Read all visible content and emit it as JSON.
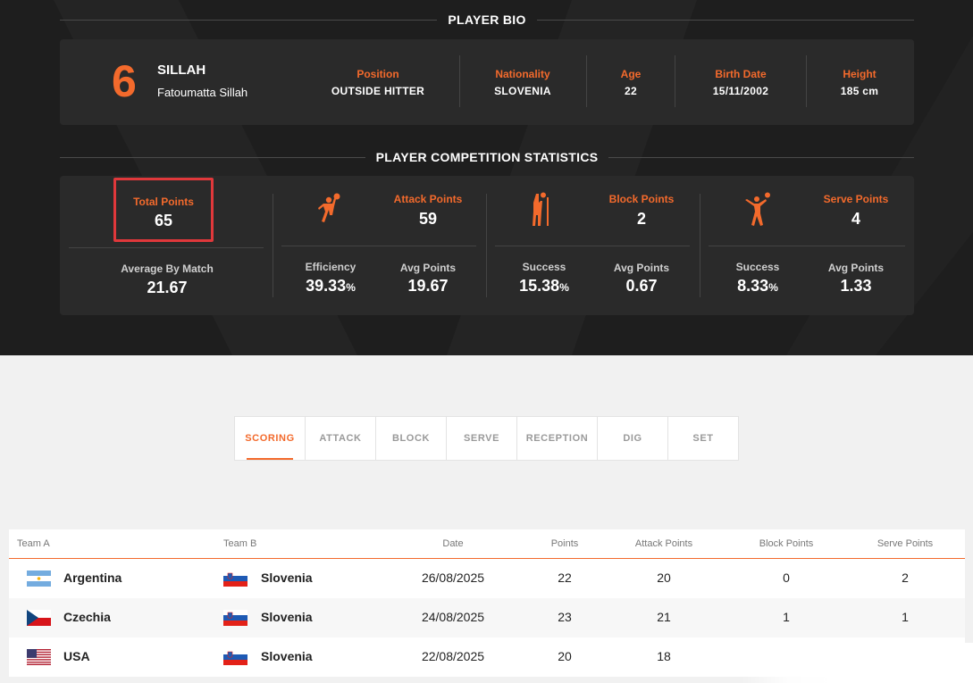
{
  "bio_title": "PLAYER BIO",
  "player": {
    "number": "6",
    "last_name": "SILLAH",
    "full_name": "Fatoumatta Sillah"
  },
  "bio_fields": [
    {
      "label": "Position",
      "value": "OUTSIDE HITTER"
    },
    {
      "label": "Nationality",
      "value": "SLOVENIA"
    },
    {
      "label": "Age",
      "value": "22"
    },
    {
      "label": "Birth Date",
      "value": "15/11/2002"
    },
    {
      "label": "Height",
      "value": "185 cm"
    }
  ],
  "stats_title": "PLAYER COMPETITION STATISTICS",
  "stats": {
    "total": {
      "label": "Total Points",
      "value": "65",
      "avg_label": "Average By Match",
      "avg_value": "21.67"
    },
    "attack": {
      "label": "Attack Points",
      "value": "59",
      "eff_label": "Efficiency",
      "eff_value": "39.33",
      "eff_unit": "%",
      "avg_label": "Avg Points",
      "avg_value": "19.67",
      "icon": "attack-icon"
    },
    "block": {
      "label": "Block Points",
      "value": "2",
      "eff_label": "Success",
      "eff_value": "15.38",
      "eff_unit": "%",
      "avg_label": "Avg Points",
      "avg_value": "0.67",
      "icon": "block-icon"
    },
    "serve": {
      "label": "Serve Points",
      "value": "4",
      "eff_label": "Success",
      "eff_value": "8.33",
      "eff_unit": "%",
      "avg_label": "Avg Points",
      "avg_value": "1.33",
      "icon": "serve-icon"
    }
  },
  "tabs": [
    "SCORING",
    "ATTACK",
    "BLOCK",
    "SERVE",
    "RECEPTION",
    "DIG",
    "SET"
  ],
  "active_tab": "SCORING",
  "table": {
    "headers": [
      "Team A",
      "Team B",
      "Date",
      "Points",
      "Attack Points",
      "Block Points",
      "Serve Points"
    ],
    "rows": [
      {
        "team_a": "Argentina",
        "team_b": "Slovenia",
        "date": "26/08/2025",
        "points": "22",
        "attack": "20",
        "block": "0",
        "serve": "2"
      },
      {
        "team_a": "Czechia",
        "team_b": "Slovenia",
        "date": "24/08/2025",
        "points": "23",
        "attack": "21",
        "block": "1",
        "serve": "1"
      },
      {
        "team_a": "USA",
        "team_b": "Slovenia",
        "date": "22/08/2025",
        "points": "20",
        "attack": "18",
        "block": "",
        "serve": ""
      }
    ]
  },
  "colors": {
    "accent": "#f36a2c",
    "dark_bg": "#1e1e1e",
    "card_bg": "#2a2a2a",
    "highlight_border": "#e0383b"
  }
}
